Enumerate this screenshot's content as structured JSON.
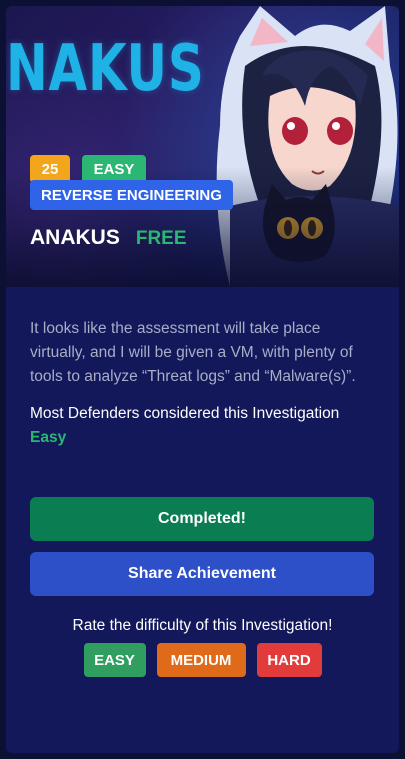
{
  "banner": {
    "big_title": "NAKUS",
    "points": "25",
    "level": "EASY",
    "category": "REVERSE ENGINEERING",
    "room_name": "ANAKUS",
    "price": "FREE"
  },
  "content": {
    "description": "It looks like the assessment will take place virtually, and I will be given a VM, with plenty of tools to analyze “Threat logs” and “Malware(s)”.",
    "consensus_prefix": "Most Defenders considered this Investigation ",
    "consensus_level": "Easy"
  },
  "actions": {
    "completed_label": "Completed!",
    "share_label": "Share Achievement"
  },
  "rating": {
    "prompt": "Rate the difficulty of this Investigation!",
    "easy": "EASY",
    "medium": "MEDIUM",
    "hard": "HARD"
  },
  "colors": {
    "card_bg": "#12185a",
    "accent_green": "#2bb673",
    "accent_blue": "#2f63e8",
    "points_orange": "#f3a51c",
    "completed_green": "#0a7d52",
    "share_blue": "#2d4fc7",
    "hard_red": "#e23b3b",
    "medium_orange": "#de6a1a"
  }
}
